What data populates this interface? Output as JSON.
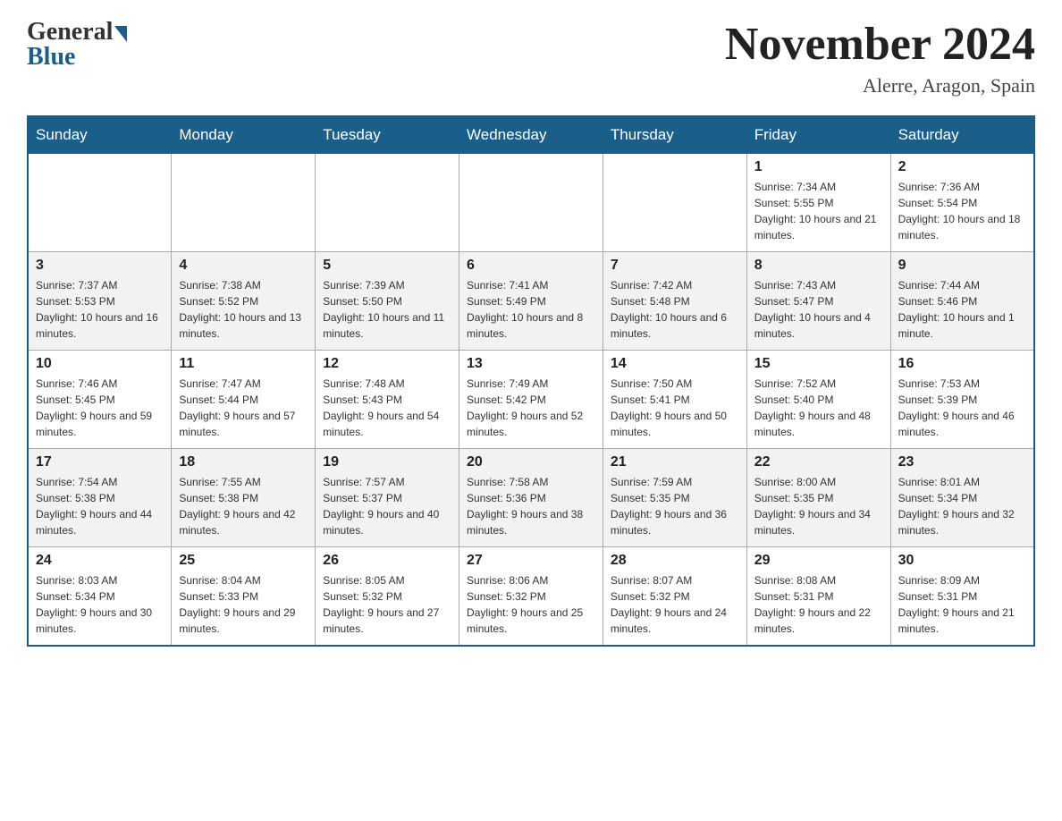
{
  "header": {
    "logo_general": "General",
    "logo_blue": "Blue",
    "month_title": "November 2024",
    "location": "Alerre, Aragon, Spain"
  },
  "days_of_week": [
    "Sunday",
    "Monday",
    "Tuesday",
    "Wednesday",
    "Thursday",
    "Friday",
    "Saturday"
  ],
  "weeks": [
    [
      {
        "day": "",
        "sunrise": "",
        "sunset": "",
        "daylight": ""
      },
      {
        "day": "",
        "sunrise": "",
        "sunset": "",
        "daylight": ""
      },
      {
        "day": "",
        "sunrise": "",
        "sunset": "",
        "daylight": ""
      },
      {
        "day": "",
        "sunrise": "",
        "sunset": "",
        "daylight": ""
      },
      {
        "day": "",
        "sunrise": "",
        "sunset": "",
        "daylight": ""
      },
      {
        "day": "1",
        "sunrise": "Sunrise: 7:34 AM",
        "sunset": "Sunset: 5:55 PM",
        "daylight": "Daylight: 10 hours and 21 minutes."
      },
      {
        "day": "2",
        "sunrise": "Sunrise: 7:36 AM",
        "sunset": "Sunset: 5:54 PM",
        "daylight": "Daylight: 10 hours and 18 minutes."
      }
    ],
    [
      {
        "day": "3",
        "sunrise": "Sunrise: 7:37 AM",
        "sunset": "Sunset: 5:53 PM",
        "daylight": "Daylight: 10 hours and 16 minutes."
      },
      {
        "day": "4",
        "sunrise": "Sunrise: 7:38 AM",
        "sunset": "Sunset: 5:52 PM",
        "daylight": "Daylight: 10 hours and 13 minutes."
      },
      {
        "day": "5",
        "sunrise": "Sunrise: 7:39 AM",
        "sunset": "Sunset: 5:50 PM",
        "daylight": "Daylight: 10 hours and 11 minutes."
      },
      {
        "day": "6",
        "sunrise": "Sunrise: 7:41 AM",
        "sunset": "Sunset: 5:49 PM",
        "daylight": "Daylight: 10 hours and 8 minutes."
      },
      {
        "day": "7",
        "sunrise": "Sunrise: 7:42 AM",
        "sunset": "Sunset: 5:48 PM",
        "daylight": "Daylight: 10 hours and 6 minutes."
      },
      {
        "day": "8",
        "sunrise": "Sunrise: 7:43 AM",
        "sunset": "Sunset: 5:47 PM",
        "daylight": "Daylight: 10 hours and 4 minutes."
      },
      {
        "day": "9",
        "sunrise": "Sunrise: 7:44 AM",
        "sunset": "Sunset: 5:46 PM",
        "daylight": "Daylight: 10 hours and 1 minute."
      }
    ],
    [
      {
        "day": "10",
        "sunrise": "Sunrise: 7:46 AM",
        "sunset": "Sunset: 5:45 PM",
        "daylight": "Daylight: 9 hours and 59 minutes."
      },
      {
        "day": "11",
        "sunrise": "Sunrise: 7:47 AM",
        "sunset": "Sunset: 5:44 PM",
        "daylight": "Daylight: 9 hours and 57 minutes."
      },
      {
        "day": "12",
        "sunrise": "Sunrise: 7:48 AM",
        "sunset": "Sunset: 5:43 PM",
        "daylight": "Daylight: 9 hours and 54 minutes."
      },
      {
        "day": "13",
        "sunrise": "Sunrise: 7:49 AM",
        "sunset": "Sunset: 5:42 PM",
        "daylight": "Daylight: 9 hours and 52 minutes."
      },
      {
        "day": "14",
        "sunrise": "Sunrise: 7:50 AM",
        "sunset": "Sunset: 5:41 PM",
        "daylight": "Daylight: 9 hours and 50 minutes."
      },
      {
        "day": "15",
        "sunrise": "Sunrise: 7:52 AM",
        "sunset": "Sunset: 5:40 PM",
        "daylight": "Daylight: 9 hours and 48 minutes."
      },
      {
        "day": "16",
        "sunrise": "Sunrise: 7:53 AM",
        "sunset": "Sunset: 5:39 PM",
        "daylight": "Daylight: 9 hours and 46 minutes."
      }
    ],
    [
      {
        "day": "17",
        "sunrise": "Sunrise: 7:54 AM",
        "sunset": "Sunset: 5:38 PM",
        "daylight": "Daylight: 9 hours and 44 minutes."
      },
      {
        "day": "18",
        "sunrise": "Sunrise: 7:55 AM",
        "sunset": "Sunset: 5:38 PM",
        "daylight": "Daylight: 9 hours and 42 minutes."
      },
      {
        "day": "19",
        "sunrise": "Sunrise: 7:57 AM",
        "sunset": "Sunset: 5:37 PM",
        "daylight": "Daylight: 9 hours and 40 minutes."
      },
      {
        "day": "20",
        "sunrise": "Sunrise: 7:58 AM",
        "sunset": "Sunset: 5:36 PM",
        "daylight": "Daylight: 9 hours and 38 minutes."
      },
      {
        "day": "21",
        "sunrise": "Sunrise: 7:59 AM",
        "sunset": "Sunset: 5:35 PM",
        "daylight": "Daylight: 9 hours and 36 minutes."
      },
      {
        "day": "22",
        "sunrise": "Sunrise: 8:00 AM",
        "sunset": "Sunset: 5:35 PM",
        "daylight": "Daylight: 9 hours and 34 minutes."
      },
      {
        "day": "23",
        "sunrise": "Sunrise: 8:01 AM",
        "sunset": "Sunset: 5:34 PM",
        "daylight": "Daylight: 9 hours and 32 minutes."
      }
    ],
    [
      {
        "day": "24",
        "sunrise": "Sunrise: 8:03 AM",
        "sunset": "Sunset: 5:34 PM",
        "daylight": "Daylight: 9 hours and 30 minutes."
      },
      {
        "day": "25",
        "sunrise": "Sunrise: 8:04 AM",
        "sunset": "Sunset: 5:33 PM",
        "daylight": "Daylight: 9 hours and 29 minutes."
      },
      {
        "day": "26",
        "sunrise": "Sunrise: 8:05 AM",
        "sunset": "Sunset: 5:32 PM",
        "daylight": "Daylight: 9 hours and 27 minutes."
      },
      {
        "day": "27",
        "sunrise": "Sunrise: 8:06 AM",
        "sunset": "Sunset: 5:32 PM",
        "daylight": "Daylight: 9 hours and 25 minutes."
      },
      {
        "day": "28",
        "sunrise": "Sunrise: 8:07 AM",
        "sunset": "Sunset: 5:32 PM",
        "daylight": "Daylight: 9 hours and 24 minutes."
      },
      {
        "day": "29",
        "sunrise": "Sunrise: 8:08 AM",
        "sunset": "Sunset: 5:31 PM",
        "daylight": "Daylight: 9 hours and 22 minutes."
      },
      {
        "day": "30",
        "sunrise": "Sunrise: 8:09 AM",
        "sunset": "Sunset: 5:31 PM",
        "daylight": "Daylight: 9 hours and 21 minutes."
      }
    ]
  ]
}
